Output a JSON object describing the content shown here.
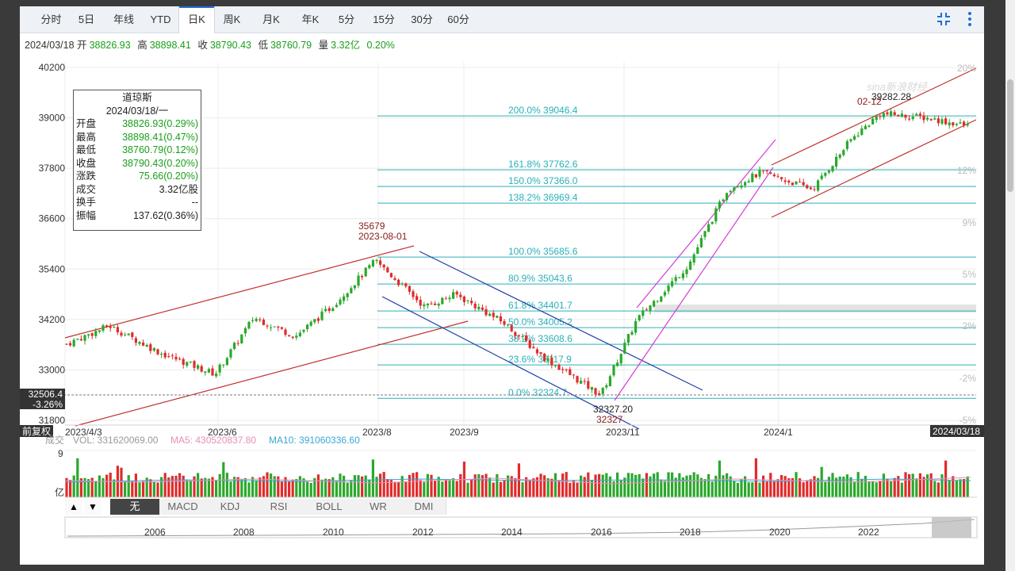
{
  "tabs": [
    {
      "label": "分时"
    },
    {
      "label": "5日"
    },
    {
      "label": "年线"
    },
    {
      "label": "YTD"
    },
    {
      "label": "日K",
      "active": true
    },
    {
      "label": "周K"
    },
    {
      "label": "月K"
    },
    {
      "label": "年K"
    },
    {
      "label": "5分"
    },
    {
      "label": "15分"
    },
    {
      "label": "30分"
    },
    {
      "label": "60分"
    }
  ],
  "header": {
    "date": "2024/03/18",
    "open_label": "开",
    "open": "38826.93",
    "high_label": "高",
    "high": "38898.41",
    "close_label": "收",
    "close": "38790.43",
    "low_label": "低",
    "low": "38760.79",
    "vol_label": "量",
    "vol": "3.32亿",
    "pct": "0.20%"
  },
  "tools": {
    "fullscreen_icon": "compress-icon",
    "menu_icon": "kebab-menu-icon"
  },
  "infobox": {
    "name": "道琼斯",
    "date": "2024/03/18/一",
    "rows": [
      {
        "k": "开盘",
        "v": "38826.93(0.29%)",
        "green": true
      },
      {
        "k": "最高",
        "v": "38898.41(0.47%)",
        "green": true
      },
      {
        "k": "最低",
        "v": "38760.79(0.12%)",
        "green": true
      },
      {
        "k": "收盘",
        "v": "38790.43(0.20%)",
        "green": true
      },
      {
        "k": "涨跌",
        "v": "75.66(0.20%)",
        "green": true
      },
      {
        "k": "成交",
        "v": "3.32亿股",
        "green": false
      },
      {
        "k": "换手",
        "v": "--",
        "green": false
      },
      {
        "k": "振幅",
        "v": "137.62(0.36%)",
        "green": false
      }
    ]
  },
  "chart_data": {
    "type": "candlestick",
    "colors": {
      "up": "#2ba82b",
      "down": "#e02b2b",
      "channel_red": "#c0322f",
      "channel_blue": "#1f3fa8",
      "channel_magenta": "#d63bd6",
      "fib": "#2bb0b8",
      "label": "#8b1b1b"
    },
    "y_ticks": [
      "40200",
      "39000",
      "37800",
      "36600",
      "35400",
      "34200",
      "33000",
      "31800"
    ],
    "ylim": [
      31800,
      40200
    ],
    "x_ticks": [
      "2023/4/3",
      "2023/6",
      "2023/8",
      "2023/9",
      "2023/11",
      "2024/1"
    ],
    "right_pct_ticks": [
      "20%",
      "12%",
      "9%",
      "5%",
      "2%",
      "-2%",
      "-5%"
    ],
    "crosshair": {
      "price": "32506.4",
      "pct": "-3.26%",
      "date": "2024/03/18",
      "left_label": "前复权"
    },
    "watermark": "sina新浪财经",
    "fib_levels": [
      {
        "label": "200.0% 39046.4",
        "value": 39046.4
      },
      {
        "label": "161.8% 37762.6",
        "value": 37762.6
      },
      {
        "label": "150.0% 37366.0",
        "value": 37366.0
      },
      {
        "label": "138.2% 36969.4",
        "value": 36969.4
      },
      {
        "label": "100.0% 35685.6",
        "value": 35685.6
      },
      {
        "label": "80.9% 35043.6",
        "value": 35043.6
      },
      {
        "label": "61.8% 34401.7",
        "value": 34401.7
      },
      {
        "label": "50.0% 34005.2",
        "value": 34005.2
      },
      {
        "label": "38.2% 33608.6",
        "value": 33608.6
      },
      {
        "label": "23.6% 33117.9",
        "value": 33117.9
      },
      {
        "label": "0.0% 32324.7",
        "value": 32324.7
      }
    ],
    "annotations": [
      {
        "text": "35679",
        "tone": "label"
      },
      {
        "text": "2023-08-01",
        "tone": "label"
      },
      {
        "text": "39282.28",
        "tone": "dark"
      },
      {
        "text": "02-12",
        "tone": "label"
      },
      {
        "text": "32327.20",
        "tone": "dark"
      },
      {
        "text": "32327",
        "tone": "label"
      }
    ],
    "series": [
      {
        "name": "收盘",
        "approx_points": [
          [
            "2023/4/3",
            33600
          ],
          [
            "2023/4/20",
            34050
          ],
          [
            "2023/5/10",
            33400
          ],
          [
            "2023/5/31",
            32900
          ],
          [
            "2023/6/15",
            34250
          ],
          [
            "2023/7/1",
            33800
          ],
          [
            "2023/7/15",
            34500
          ],
          [
            "2023/8/1",
            35600
          ],
          [
            "2023/8/20",
            34500
          ],
          [
            "2023/9/1",
            34800
          ],
          [
            "2023/9/20",
            34100
          ],
          [
            "2023/10/5",
            33300
          ],
          [
            "2023/10/27",
            32400
          ],
          [
            "2023/11/10",
            34200
          ],
          [
            "2023/11/30",
            35500
          ],
          [
            "2023/12/15",
            37300
          ],
          [
            "2023/12/28",
            37700
          ],
          [
            "2024/1/17",
            37300
          ],
          [
            "2024/2/1",
            38500
          ],
          [
            "2024/2/12",
            39100
          ],
          [
            "2024/3/1",
            39000
          ],
          [
            "2024/3/18",
            38790
          ]
        ]
      }
    ],
    "volume": {
      "label": "成交",
      "vol_text": "VOL: 331620069.00",
      "ma5_text": "MA5: 430520837.80",
      "ma10_text": "MA10: 391060336.60",
      "y_top": "9",
      "unit": "亿"
    },
    "navigator": {
      "years": [
        "2006",
        "2008",
        "2010",
        "2012",
        "2014",
        "2016",
        "2018",
        "2020",
        "2022"
      ]
    }
  },
  "indicator_tabs": [
    {
      "label": "无",
      "active": true
    },
    {
      "label": "MACD"
    },
    {
      "label": "KDJ"
    },
    {
      "label": "RSI"
    },
    {
      "label": "BOLL"
    },
    {
      "label": "WR"
    },
    {
      "label": "DMI"
    }
  ]
}
